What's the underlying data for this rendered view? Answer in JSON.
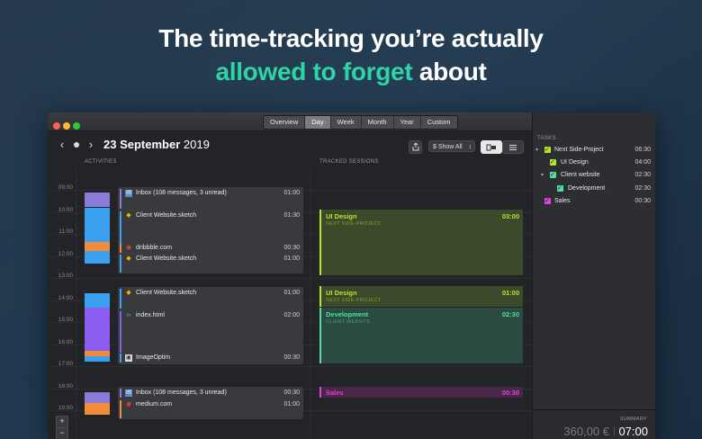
{
  "headline": {
    "line1": "The time-tracking you’re actually",
    "accent": "allowed to forget",
    "line2_rest": " about"
  },
  "view_tabs": [
    {
      "label": "Overview",
      "active": false
    },
    {
      "label": "Day",
      "active": true
    },
    {
      "label": "Week",
      "active": false
    },
    {
      "label": "Month",
      "active": false
    },
    {
      "label": "Year",
      "active": false
    },
    {
      "label": "Custom",
      "active": false
    }
  ],
  "date": {
    "day": "23 September",
    "year": "2019"
  },
  "toolbar": {
    "share_icon": "share-icon",
    "filter_label": "$ Show All",
    "filter_arrows": "↕"
  },
  "columns": {
    "activities": "ACTIVITIES",
    "tracked_sessions": "TRACKED SESSIONS"
  },
  "hours": [
    "09:00",
    "10:00",
    "11:00",
    "12:00",
    "13:00",
    "14:00",
    "15:00",
    "16:00",
    "17:00",
    "18:00",
    "19:00"
  ],
  "activities": [
    {
      "name": "Inbox (108 messages, 3 unread)",
      "duration": "01:00",
      "icon": "mail-icon",
      "color": "#8b7bd8"
    },
    {
      "name": "Client Website.sketch",
      "duration": "01:30",
      "icon": "sketch-icon",
      "color": "#3aa0f0"
    },
    {
      "name": "dribbble.com",
      "duration": "00:30",
      "icon": "chrome-icon",
      "color": "#f08c3a"
    },
    {
      "name": "Client Website.sketch",
      "duration": "01:00",
      "icon": "sketch-icon",
      "color": "#3aa0f0"
    },
    {
      "name": "Client Website.sketch",
      "duration": "01:00",
      "icon": "sketch-icon",
      "color": "#3aa0f0"
    },
    {
      "name": "index.html",
      "duration": "02:00",
      "icon": "code-icon",
      "color": "#8b5cf0"
    },
    {
      "name": "ImageOptim",
      "duration": "00:30",
      "icon": "imageoptim-icon",
      "color": "#3aa0f0"
    },
    {
      "name": "Inbox (108 messages, 3 unread)",
      "duration": "00:30",
      "icon": "mail-icon",
      "color": "#8b7bd8"
    },
    {
      "name": "medium.com",
      "duration": "01:00",
      "icon": "chrome-icon",
      "color": "#f08c3a"
    }
  ],
  "sessions": [
    {
      "title": "UI Design",
      "project": "NEXT SIDE-PROJECT",
      "duration": "03:00",
      "color": "#b6e62a",
      "bg": "#3b4a2a"
    },
    {
      "title": "UI Design",
      "project": "NEXT SIDE-PROJECT",
      "duration": "01:00",
      "color": "#b6e62a",
      "bg": "#3b4a2a"
    },
    {
      "title": "Development",
      "project": "CLIENT WEBSITE",
      "duration": "02:30",
      "color": "#4fe0a0",
      "bg": "#2b4a40"
    },
    {
      "title": "Sales",
      "project": "",
      "duration": "00:30",
      "color": "#e040d8",
      "bg": "#4a2648"
    }
  ],
  "tasks_header": "TASKS",
  "tasks": [
    {
      "name": "Next Side-Project",
      "time": "06:30",
      "level": 0,
      "disclosure": "▾",
      "color": "#b6e62a"
    },
    {
      "name": "UI Design",
      "time": "04:00",
      "level": 1,
      "disclosure": "",
      "color": "#b6e62a"
    },
    {
      "name": "Client website",
      "time": "02:30",
      "level": 1,
      "disclosure": "▾",
      "color": "#4fe0a0"
    },
    {
      "name": "Development",
      "time": "02:30",
      "level": 2,
      "disclosure": "",
      "color": "#4fe0a0"
    },
    {
      "name": "Sales",
      "time": "00:30",
      "level": 0,
      "disclosure": "",
      "color": "#e040d8"
    }
  ],
  "summary": {
    "label": "SUMMARY",
    "money": "360,00 €",
    "separator": "|",
    "total": "07:00"
  },
  "zoom": {
    "in": "+",
    "out": "−"
  }
}
